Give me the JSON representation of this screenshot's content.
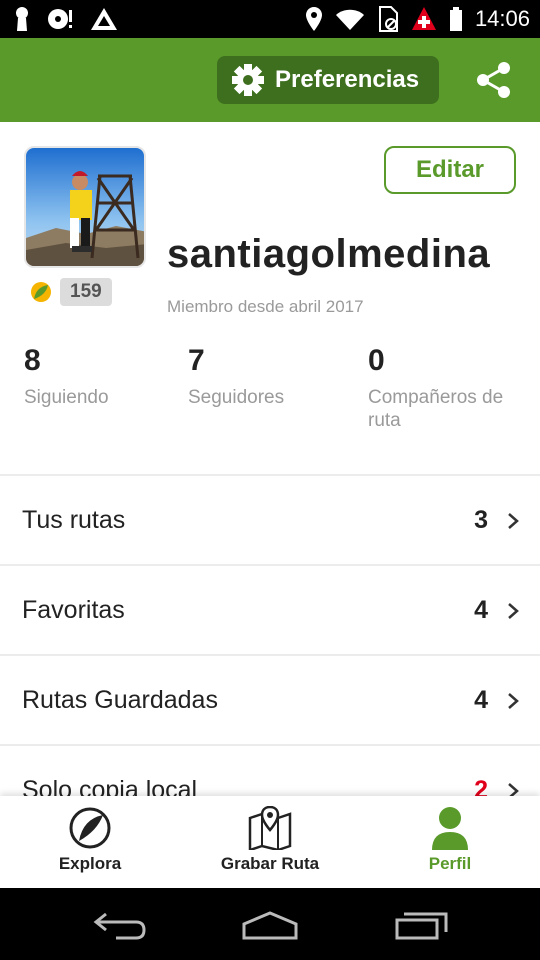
{
  "status_bar": {
    "time": "14:06",
    "left_icons": [
      "keyhole-icon",
      "disc-alert-icon",
      "mountain-logo-icon"
    ],
    "right_icons": [
      "location-pin-icon",
      "wifi-icon",
      "sim-card-icon",
      "swiss-flag-icon",
      "battery-icon"
    ]
  },
  "app_bar": {
    "background": "#5a9a2b",
    "preferences_label": "Preferencias",
    "preferences_icon": "gear-icon",
    "share_icon": "share-icon"
  },
  "profile": {
    "username": "santiagolmedina",
    "member_since": "Miembro desde abril 2017",
    "badge_count": "159",
    "edit_label": "Editar",
    "stats": [
      {
        "value": "8",
        "label": "Siguiendo"
      },
      {
        "value": "7",
        "label": "Seguidores"
      },
      {
        "value": "0",
        "label": "Compañeros de ruta"
      }
    ]
  },
  "list": [
    {
      "label": "Tus rutas",
      "count": "3",
      "count_color": "#222222"
    },
    {
      "label": "Favoritas",
      "count": "4",
      "count_color": "#222222"
    },
    {
      "label": "Rutas Guardadas",
      "count": "4",
      "count_color": "#222222"
    },
    {
      "label": "Solo copia local",
      "count": "2",
      "count_color": "#e0001b"
    }
  ],
  "bottom_nav": [
    {
      "label": "Explora",
      "icon": "wikiloc-logo-icon",
      "active": false
    },
    {
      "label": "Grabar Ruta",
      "icon": "map-pin-icon",
      "active": false
    },
    {
      "label": "Perfil",
      "icon": "person-icon",
      "active": true
    }
  ],
  "colors": {
    "accent": "#5a9a2b",
    "accent_dark": "#3d6f1e",
    "alert": "#e0001b"
  }
}
